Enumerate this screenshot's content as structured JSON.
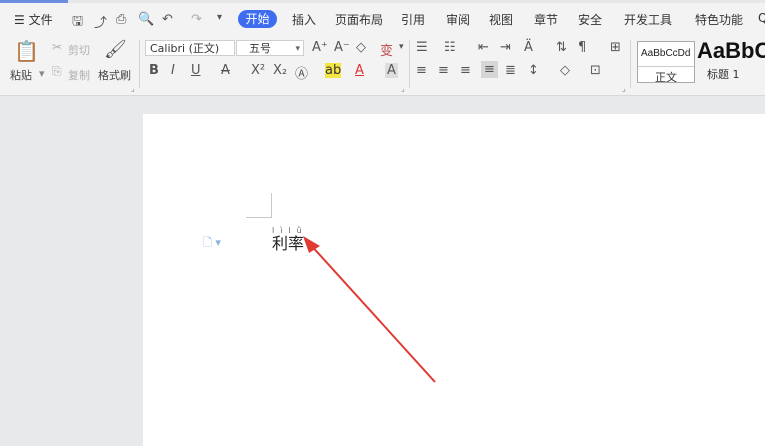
{
  "menu": {
    "file": "☰ 文件",
    "start": "开始",
    "items": [
      "插入",
      "页面布局",
      "引用",
      "审阅",
      "视图",
      "章节",
      "安全",
      "开发工具",
      "特色功能"
    ]
  },
  "ribbon": {
    "paste": "粘贴",
    "cut": "剪切",
    "copy": "复制",
    "format_painter": "格式刷",
    "font_name": "Calibri (正文)",
    "font_size": "五号",
    "style_normal_sample": "AaBbCcDd",
    "style_normal_name": "正文",
    "style_h1_sample": "AaBbC",
    "style_h1_name": "标题 1"
  },
  "document": {
    "text": "利率",
    "ruby": "lìlǜ"
  },
  "colors": {
    "accent": "#3f6df0",
    "arrow": "#e03a33"
  }
}
